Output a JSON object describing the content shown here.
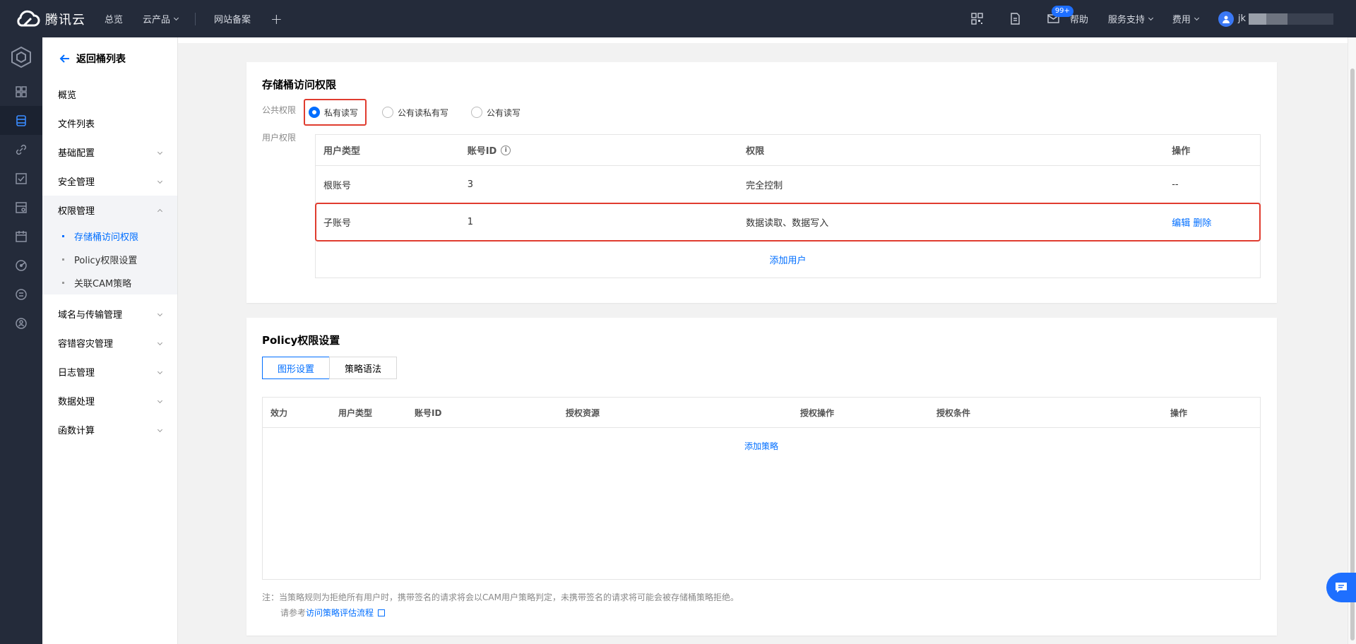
{
  "brand": {
    "name": "腾讯云"
  },
  "topnav": {
    "items": [
      "总览",
      "云产品",
      "网站备案"
    ]
  },
  "topright": {
    "badge": "99+",
    "help": "帮助",
    "support": "服务支持",
    "billing": "费用",
    "user_initial": "jk"
  },
  "sidebar": {
    "back": "返回桶列表",
    "items": [
      {
        "label": "概览"
      },
      {
        "label": "文件列表"
      },
      {
        "label": "基础配置"
      },
      {
        "label": "安全管理"
      },
      {
        "label": "权限管理"
      }
    ],
    "sub_items": [
      {
        "label": "存储桶访问权限"
      },
      {
        "label": "Policy权限设置"
      },
      {
        "label": "关联CAM策略"
      }
    ],
    "items_after": [
      {
        "label": "域名与传输管理"
      },
      {
        "label": "容错容灾管理"
      },
      {
        "label": "日志管理"
      },
      {
        "label": "数据处理"
      },
      {
        "label": "函数计算"
      }
    ]
  },
  "bucket_access": {
    "title": "存储桶访问权限",
    "public_label": "公共权限",
    "user_label": "用户权限",
    "radios": [
      "私有读写",
      "公有读私有写",
      "公有读写"
    ],
    "selected": "私有读写",
    "table": {
      "headers": [
        "用户类型",
        "账号ID",
        "权限",
        "操作"
      ],
      "rows": [
        {
          "type": "根账号",
          "id": "3",
          "perm": "完全控制",
          "op": "--"
        },
        {
          "type": "子账号",
          "id": "1",
          "perm": "数据读取、数据写入",
          "op_edit": "编辑",
          "op_delete": "删除"
        }
      ],
      "add": "添加用户"
    }
  },
  "policy": {
    "title": "Policy权限设置",
    "tabs": [
      "图形设置",
      "策略语法"
    ],
    "headers": [
      "效力",
      "用户类型",
      "账号ID",
      "授权资源",
      "授权操作",
      "授权条件",
      "操作"
    ],
    "add": "添加策略",
    "note_line1": "注：当策略规则为拒绝所有用户时，携带签名的请求将会以CAM用户策略判定，未携带签名的请求将可能会被存储桶策略拒绝。",
    "note_line2_prefix": "请参考",
    "note_link": "访问策略评估流程"
  },
  "colors": {
    "accent": "#006eff",
    "highlight": "#e03c2f",
    "nav_bg": "#242b3a"
  }
}
